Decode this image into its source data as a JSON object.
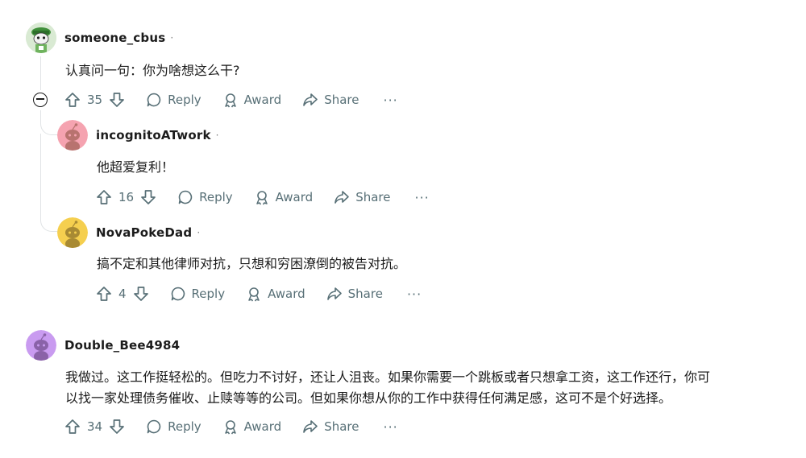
{
  "comments": [
    {
      "username": "someone_cbus",
      "text": "认真问一句：你为啥想这么干?",
      "votes": "35",
      "avatar": "green-snoo-avatar"
    },
    {
      "username": "incognitoATwork",
      "text": "他超爱复利！",
      "votes": "16",
      "avatar": "pink-default-avatar"
    },
    {
      "username": "NovaPokeDad",
      "text": "搞不定和其他律师对抗，只想和穷困潦倒的被告对抗。",
      "votes": "4",
      "avatar": "yellow-default-avatar"
    },
    {
      "username": "Double_Bee4984",
      "text": "我做过。这工作挺轻松的。但吃力不讨好，还让人沮丧。如果你需要一个跳板或者只想拿工资，这工作还行，你可\n以找一家处理债务催收、止赎等等的公司。但如果你想从你的工作中获得任何满足感，这可不是个好选择。",
      "votes": "34",
      "avatar": "purple-default-avatar"
    }
  ],
  "actions": {
    "reply": "Reply",
    "award": "Award",
    "share": "Share",
    "more": "···"
  },
  "separator": "·",
  "colors": {
    "meta": "#576f76",
    "thread_line": "#e0e3e5",
    "avatar_pink": "#f5a3b0",
    "avatar_yellow": "#f5cf4f",
    "avatar_purple": "#c99bf0"
  }
}
